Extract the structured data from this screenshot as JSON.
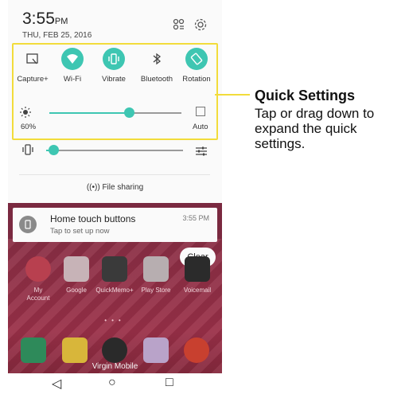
{
  "status": {
    "time": "3:55",
    "ampm": "PM",
    "date": "THU, FEB 25, 2016"
  },
  "header_icons": [
    "edit-tiles-icon",
    "gear-icon"
  ],
  "quick_settings": {
    "tiles": [
      {
        "label": "Capture+",
        "icon": "capture-icon",
        "on": false
      },
      {
        "label": "Wi-Fi",
        "icon": "wifi-icon",
        "on": true
      },
      {
        "label": "Vibrate",
        "icon": "vibrate-icon",
        "on": true
      },
      {
        "label": "Bluetooth",
        "icon": "bluetooth-icon",
        "on": false
      },
      {
        "label": "Rotation",
        "icon": "rotation-icon",
        "on": true
      }
    ],
    "brightness": {
      "percent_label": "60%",
      "level": 0.6,
      "auto_label": "Auto"
    },
    "volume": {
      "level": 0.05
    },
    "file_sharing_label": "File sharing"
  },
  "notification": {
    "title": "Home touch buttons",
    "subtitle": "Tap to set up now",
    "time": "3:55 PM"
  },
  "clear_label": "Clear",
  "apps": [
    {
      "label": "My\nAccount",
      "color": "#b8404f"
    },
    {
      "label": "Google",
      "color": "#c7b3b7"
    },
    {
      "label": "QuickMemo+",
      "color": "#3a3a3a"
    },
    {
      "label": "Play Store",
      "color": "#b7aeb0"
    },
    {
      "label": "Voicemail",
      "color": "#2b2b2b"
    }
  ],
  "dock": {
    "carrier_label": "Virgin Mobile"
  },
  "callout": {
    "title": "Quick Settings",
    "text": "Tap or drag down to expand the quick settings."
  },
  "colors": {
    "accent": "#3ec6b2",
    "highlight": "#f2dc3b",
    "wallpaper": "#8a2f45"
  }
}
